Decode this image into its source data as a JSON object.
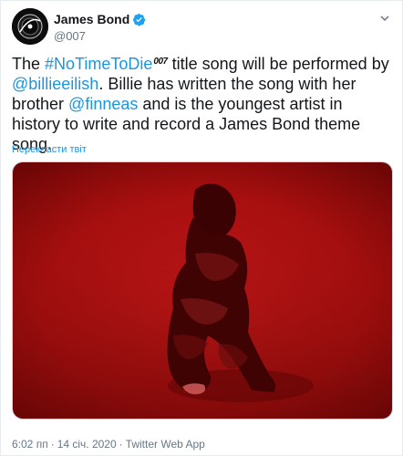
{
  "author": {
    "display_name": "James Bond",
    "handle": "@007",
    "verified": true
  },
  "tweet": {
    "text_1": "The ",
    "hashtag": "#NoTimeToDie",
    "hashtag_logo": "007",
    "text_2": " title song will be performed by ",
    "mention_1": "@billieeilish",
    "text_3": ". Billie has written the song with her brother ",
    "mention_2": "@finneas",
    "text_4": " and is the youngest artist in history to write and record a James Bond theme song."
  },
  "translate_label": "Перекласти твіт",
  "media": {
    "icon": "photo",
    "dominant_color": "#b01010"
  },
  "meta": {
    "time": "6:02 пп",
    "date": "14 січ. 2020",
    "sep": "·",
    "source": "Twitter Web App"
  },
  "colors": {
    "link": "#1b95e0",
    "verified": "#1da1f2",
    "secondary": "#657786"
  }
}
